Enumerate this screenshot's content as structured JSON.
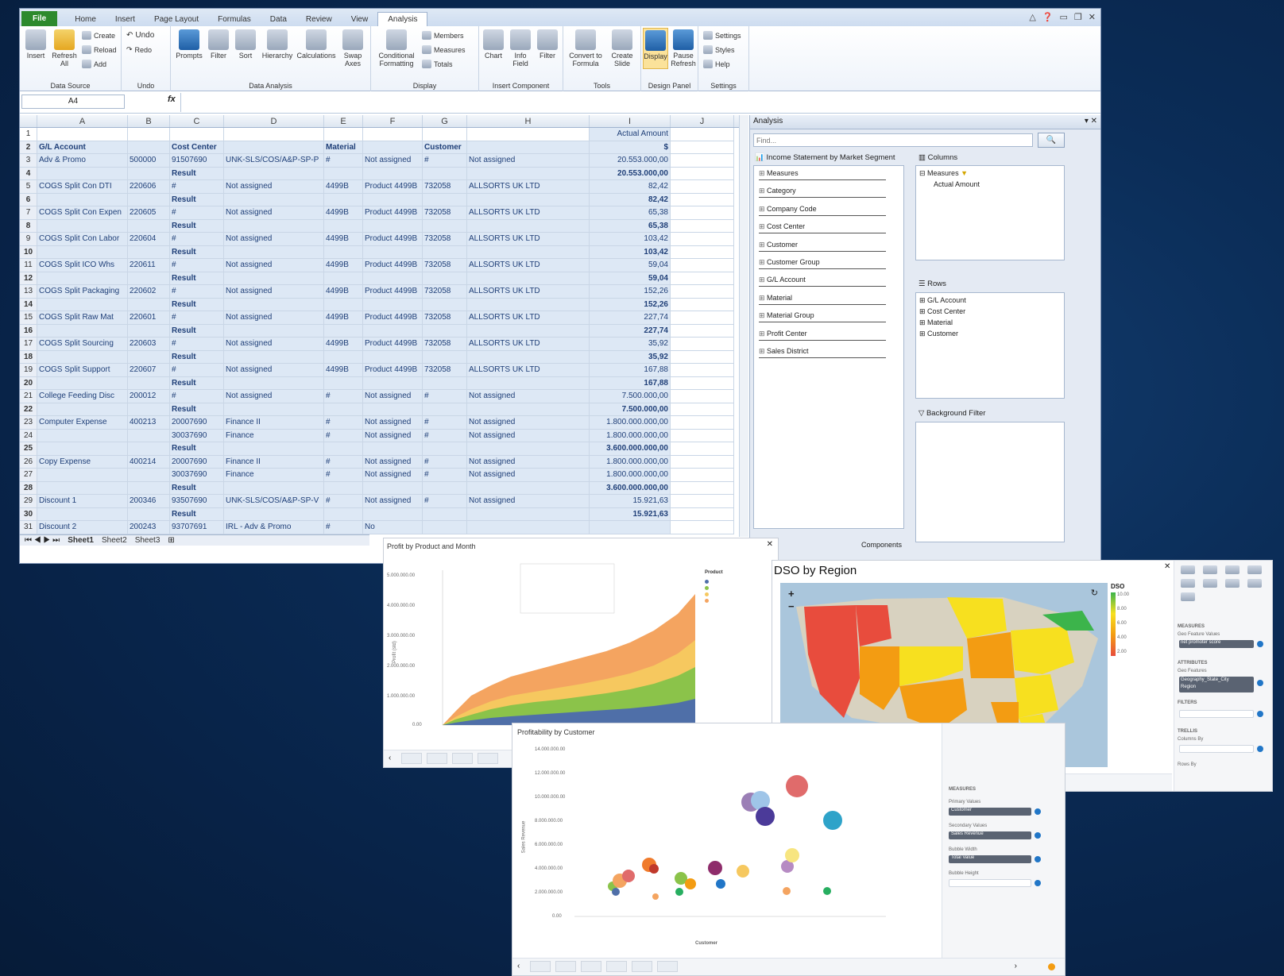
{
  "excel": {
    "tabs": [
      "File",
      "Home",
      "Insert",
      "Page Layout",
      "Formulas",
      "Data",
      "Review",
      "View",
      "Analysis"
    ],
    "ribbon": {
      "data_source": {
        "label": "Data Source",
        "insert": "Insert",
        "refresh": "Refresh All",
        "create": "Create",
        "reload": "Reload",
        "add": "Add"
      },
      "undo": {
        "label": "Undo",
        "undo": "Undo",
        "redo": "Redo"
      },
      "data_analysis": {
        "label": "Data Analysis",
        "prompts": "Prompts",
        "filter": "Filter",
        "sort": "Sort",
        "hierarchy": "Hierarchy",
        "calculations": "Calculations",
        "swap": "Swap Axes"
      },
      "display": {
        "label": "Display",
        "conditional": "Conditional Formatting",
        "members": "Members",
        "measures": "Measures",
        "totals": "Totals"
      },
      "insert_component": {
        "label": "Insert Component",
        "chart": "Chart",
        "info": "Info Field",
        "filter": "Filter"
      },
      "tools": {
        "label": "Tools",
        "convert": "Convert to Formula",
        "create_slide": "Create Slide"
      },
      "design_panel": {
        "label": "Design Panel",
        "display": "Display",
        "pause": "Pause Refresh"
      },
      "settings": {
        "label": "Settings",
        "settings": "Settings",
        "styles": "Styles",
        "help": "Help"
      }
    },
    "name_box": "A4",
    "fx": "fx",
    "columns": [
      "A",
      "B",
      "C",
      "D",
      "E",
      "F",
      "G",
      "H",
      "I",
      "J"
    ],
    "rows": [
      [
        "1",
        "",
        "",
        "",
        "",
        "",
        "",
        "",
        "",
        "Actual Amount"
      ],
      [
        "2",
        "G/L Account",
        "",
        "Cost Center",
        "",
        "Material",
        "",
        "Customer",
        "",
        "$"
      ],
      [
        "3",
        "Adv & Promo",
        "500000",
        "91507690",
        "UNK-SLS/COS/A&P-SP-P",
        "#",
        "Not assigned",
        "#",
        "Not assigned",
        "20.553.000,00"
      ],
      [
        "4",
        "",
        "",
        "Result",
        "",
        "",
        "",
        "",
        "",
        "20.553.000,00"
      ],
      [
        "5",
        "COGS Split Con DTI",
        "220606",
        "#",
        "Not assigned",
        "4499B",
        "Product 4499B",
        "732058",
        "ALLSORTS UK LTD",
        "82,42"
      ],
      [
        "6",
        "",
        "",
        "Result",
        "",
        "",
        "",
        "",
        "",
        "82,42"
      ],
      [
        "7",
        "COGS Split Con Expen",
        "220605",
        "#",
        "Not assigned",
        "4499B",
        "Product 4499B",
        "732058",
        "ALLSORTS UK LTD",
        "65,38"
      ],
      [
        "8",
        "",
        "",
        "Result",
        "",
        "",
        "",
        "",
        "",
        "65,38"
      ],
      [
        "9",
        "COGS Split Con Labor",
        "220604",
        "#",
        "Not assigned",
        "4499B",
        "Product 4499B",
        "732058",
        "ALLSORTS UK LTD",
        "103,42"
      ],
      [
        "10",
        "",
        "",
        "Result",
        "",
        "",
        "",
        "",
        "",
        "103,42"
      ],
      [
        "11",
        "COGS Split ICO Whs",
        "220611",
        "#",
        "Not assigned",
        "4499B",
        "Product 4499B",
        "732058",
        "ALLSORTS UK LTD",
        "59,04"
      ],
      [
        "12",
        "",
        "",
        "Result",
        "",
        "",
        "",
        "",
        "",
        "59,04"
      ],
      [
        "13",
        "COGS Split Packaging",
        "220602",
        "#",
        "Not assigned",
        "4499B",
        "Product 4499B",
        "732058",
        "ALLSORTS UK LTD",
        "152,26"
      ],
      [
        "14",
        "",
        "",
        "Result",
        "",
        "",
        "",
        "",
        "",
        "152,26"
      ],
      [
        "15",
        "COGS Split Raw Mat",
        "220601",
        "#",
        "Not assigned",
        "4499B",
        "Product 4499B",
        "732058",
        "ALLSORTS UK LTD",
        "227,74"
      ],
      [
        "16",
        "",
        "",
        "Result",
        "",
        "",
        "",
        "",
        "",
        "227,74"
      ],
      [
        "17",
        "COGS Split Sourcing",
        "220603",
        "#",
        "Not assigned",
        "4499B",
        "Product 4499B",
        "732058",
        "ALLSORTS UK LTD",
        "35,92"
      ],
      [
        "18",
        "",
        "",
        "Result",
        "",
        "",
        "",
        "",
        "",
        "35,92"
      ],
      [
        "19",
        "COGS Split Support",
        "220607",
        "#",
        "Not assigned",
        "4499B",
        "Product 4499B",
        "732058",
        "ALLSORTS UK LTD",
        "167,88"
      ],
      [
        "20",
        "",
        "",
        "Result",
        "",
        "",
        "",
        "",
        "",
        "167,88"
      ],
      [
        "21",
        "College Feeding Disc",
        "200012",
        "#",
        "Not assigned",
        "#",
        "Not assigned",
        "#",
        "Not assigned",
        "7.500.000,00"
      ],
      [
        "22",
        "",
        "",
        "Result",
        "",
        "",
        "",
        "",
        "",
        "7.500.000,00"
      ],
      [
        "23",
        "Computer Expense",
        "400213",
        "20007690",
        "Finance II",
        "#",
        "Not assigned",
        "#",
        "Not assigned",
        "1.800.000.000,00"
      ],
      [
        "24",
        "",
        "",
        "30037690",
        "Finance",
        "#",
        "Not assigned",
        "#",
        "Not assigned",
        "1.800.000.000,00"
      ],
      [
        "25",
        "",
        "",
        "Result",
        "",
        "",
        "",
        "",
        "",
        "3.600.000.000,00"
      ],
      [
        "26",
        "Copy Expense",
        "400214",
        "20007690",
        "Finance II",
        "#",
        "Not assigned",
        "#",
        "Not assigned",
        "1.800.000.000,00"
      ],
      [
        "27",
        "",
        "",
        "30037690",
        "Finance",
        "#",
        "Not assigned",
        "#",
        "Not assigned",
        "1.800.000.000,00"
      ],
      [
        "28",
        "",
        "",
        "Result",
        "",
        "",
        "",
        "",
        "",
        "3.600.000.000,00"
      ],
      [
        "29",
        "Discount 1",
        "200346",
        "93507690",
        "UNK-SLS/COS/A&P-SP-V",
        "#",
        "Not assigned",
        "#",
        "Not assigned",
        "15.921,63"
      ],
      [
        "30",
        "",
        "",
        "Result",
        "",
        "",
        "",
        "",
        "",
        "15.921,63"
      ],
      [
        "31",
        "Discount 2",
        "200243",
        "93707691",
        "IRL - Adv & Promo",
        "#",
        "No",
        "",
        "",
        ""
      ]
    ],
    "sheets": [
      "Sheet1",
      "Sheet2",
      "Sheet3"
    ]
  },
  "analysis": {
    "title": "Analysis",
    "find_placeholder": "Find...",
    "source": "Income Statement by Market Segment",
    "dimensions": [
      "Measures",
      "Category",
      "Company Code",
      "Cost Center",
      "Customer",
      "Customer Group",
      "G/L Account",
      "Material",
      "Material Group",
      "Profit Center",
      "Sales District"
    ],
    "columns_label": "Columns",
    "columns_items": [
      "Measures",
      "Actual Amount"
    ],
    "rows_label": "Rows",
    "rows_items": [
      "G/L Account",
      "Cost Center",
      "Material",
      "Customer"
    ],
    "bg_filter": "Background Filter",
    "components_tab": "Components"
  },
  "panels": {
    "area": {
      "title": "Profit by Product and Month",
      "legend_title": "Product",
      "ylabel": "Profit (std)",
      "y_ticks": [
        "5.000.000.00",
        "4.000.000.00",
        "3.000.000.00",
        "2.000.000.00",
        "1.000.000.00",
        "0.00"
      ]
    },
    "map": {
      "title": "DSO by Region",
      "legend_title": "DSO",
      "legend_ticks": [
        "10.00",
        "8.00",
        "6.00",
        "4.00",
        "2.00"
      ],
      "side": {
        "measures": "MEASURES",
        "geo_label": "Geo Feature Values",
        "geo_value": "net promoter score",
        "attributes": "ATTRIBUTES",
        "attr_label": "Geo Features",
        "attr_value": "Geography_State_City",
        "attr_sub": "Region",
        "filters": "FILTERS",
        "trellis": "TRELLIS",
        "columns_by": "Columns By",
        "rows_by": "Rows By"
      }
    },
    "bubble": {
      "title": "Profitability by Customer",
      "xlabel": "Customer",
      "ylabel": "Sales Revenue",
      "y_ticks": [
        "14.000.000.00",
        "12.000.000.00",
        "10.000.000.00",
        "8.000.000.00",
        "6.000.000.00",
        "4.000.000.00",
        "2.000.000.00",
        "0.00"
      ],
      "side": {
        "measures": "MEASURES",
        "primary": "Primary Values",
        "primary_val": "Customer",
        "secondary": "Secondary Values",
        "secondary_val": "Sales Revenue",
        "width": "Bubble Width",
        "width_val": "Total Value",
        "height": "Bubble Height"
      }
    }
  },
  "colors": {
    "excel_file": "#2d8a2d",
    "cell_fill": "#dde8f5",
    "cell_text": "#1f3f78",
    "area": [
      "#f4a460",
      "#f6c85f",
      "#8bc34a",
      "#4f6fa8"
    ],
    "map": [
      "#e84c3d",
      "#f39c12",
      "#f7e01f",
      "#a8d84b",
      "#3cb44b"
    ]
  }
}
